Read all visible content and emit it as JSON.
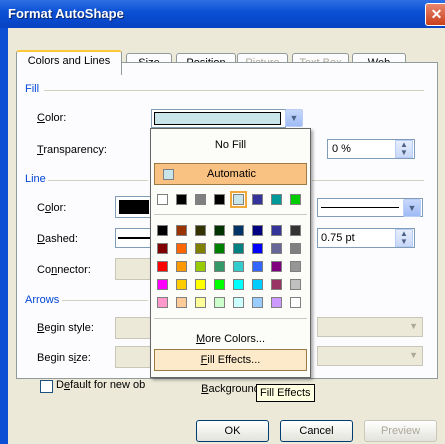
{
  "window": {
    "title": "Format AutoShape",
    "close_symbol": "✕"
  },
  "tabs": [
    {
      "label": "Colors and Lines",
      "state": "active"
    },
    {
      "label": "Size",
      "state": "normal"
    },
    {
      "label": "Position",
      "state": "normal"
    },
    {
      "label": "Picture",
      "state": "disabled"
    },
    {
      "label": "Text Box",
      "state": "disabled"
    },
    {
      "label": "Web",
      "state": "normal"
    }
  ],
  "fill": {
    "section": "Fill",
    "color_label": "Color:",
    "color_value": "#c8e6ea",
    "transparency_label": "Transparency:",
    "transparency_value": "0 %"
  },
  "line": {
    "section": "Line",
    "color_label": "Color:",
    "color_value": "#000000",
    "dashed_label": "Dashed:",
    "connector_label": "Connector:",
    "weight_value": "0.75 pt"
  },
  "arrows": {
    "section": "Arrows",
    "begin_style_label": "Begin style:",
    "begin_size_label": "Begin size:"
  },
  "default_checkbox_label": "Default for new ob",
  "color_menu": {
    "no_fill": "No Fill",
    "automatic": "Automatic",
    "more_colors": "More Colors...",
    "fill_effects": "Fill Effects...",
    "background": "Background",
    "recent_colors": [
      "#ffffff",
      "#000000",
      "#808080",
      "#000000",
      "#c8e6ea",
      "#333399",
      "#009999",
      "#00cc00"
    ],
    "palette": [
      [
        "#000000",
        "#993300",
        "#333300",
        "#003300",
        "#003366",
        "#000080",
        "#333399",
        "#333333"
      ],
      [
        "#800000",
        "#ff6600",
        "#808000",
        "#008000",
        "#008080",
        "#0000ff",
        "#666699",
        "#808080"
      ],
      [
        "#ff0000",
        "#ff9900",
        "#99cc00",
        "#339966",
        "#33cccc",
        "#3366ff",
        "#800080",
        "#969696"
      ],
      [
        "#ff00ff",
        "#ffcc00",
        "#ffff00",
        "#00ff00",
        "#00ffff",
        "#00ccff",
        "#993366",
        "#c0c0c0"
      ],
      [
        "#ff99cc",
        "#ffcc99",
        "#ffff99",
        "#ccffcc",
        "#ccffff",
        "#99ccff",
        "#cc99ff",
        "#ffffff"
      ]
    ]
  },
  "tooltip": "Fill Effects",
  "buttons": {
    "ok": "OK",
    "cancel": "Cancel",
    "preview": "Preview"
  },
  "glyphs": {
    "dropdown": "▼",
    "spin_up": "▲",
    "spin_down": "▼"
  }
}
